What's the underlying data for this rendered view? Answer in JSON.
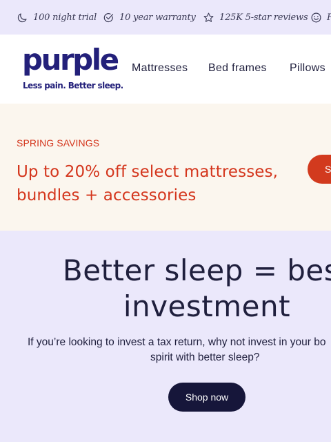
{
  "perks": [
    {
      "icon": "moon-icon",
      "label": "100 night trial"
    },
    {
      "icon": "check-circle-icon",
      "label": "10 year warranty"
    },
    {
      "icon": "star-icon",
      "label": "125K 5-star reviews"
    },
    {
      "icon": "smile-icon",
      "label": "F"
    }
  ],
  "header": {
    "logo_text": "purple",
    "tagline": "Less pain. Better sleep.",
    "nav": [
      "Mattresses",
      "Bed frames",
      "Pillows"
    ]
  },
  "promo": {
    "eyebrow": "SPRING SAVINGS",
    "headline": "Up to 20% off select mattresses, bundles + accessories",
    "button_label": "S"
  },
  "hero": {
    "title_line1": "Better sleep = best",
    "title_line2": "investment",
    "subtitle_line1": "If you’re looking to invest a tax return, why not invest in your bo",
    "subtitle_line2": "spirit with better sleep?",
    "button_label": "Shop now"
  },
  "colors": {
    "brand_purple": "#23207a",
    "promo_red": "#d4361d",
    "lavender_bg": "#ebe8fb",
    "cream_bg": "#fbf6ee",
    "navy_button": "#16163a"
  }
}
